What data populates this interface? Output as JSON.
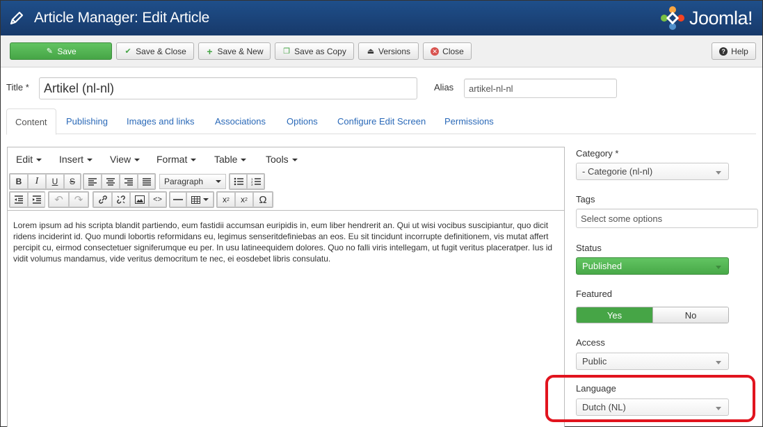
{
  "header": {
    "title": "Article Manager: Edit Article",
    "logo_text": "Joomla!",
    "bg_color": "#1f4f8a"
  },
  "toolbar": {
    "save": "Save",
    "save_close": "Save & Close",
    "save_new": "Save & New",
    "save_copy": "Save as Copy",
    "versions": "Versions",
    "close": "Close",
    "help": "Help"
  },
  "form": {
    "title_label": "Title *",
    "title_value": "Artikel (nl-nl)",
    "alias_label": "Alias",
    "alias_value": "artikel-nl-nl"
  },
  "tabs": [
    "Content",
    "Publishing",
    "Images and links",
    "Associations",
    "Options",
    "Configure Edit Screen",
    "Permissions"
  ],
  "editor": {
    "menus": [
      "Edit",
      "Insert",
      "View",
      "Format",
      "Table",
      "Tools"
    ],
    "format_select": "Paragraph",
    "body_text": "Lorem ipsum ad his scripta blandit partiendo, eum fastidii accumsan euripidis in, eum liber hendrerit an. Qui ut wisi vocibus suscipiantur, quo dicit ridens inciderint id. Quo mundi lobortis reformidans eu, legimus senseritdefiniebas an eos. Eu sit tincidunt incorrupte definitionem, vis mutat affert percipit cu, eirmod consectetuer signiferumque eu per. In usu latineequidem dolores. Quo no falli viris intellegam, ut fugit veritus placeratper. Ius id vidit volumus mandamus, vide veritus democritum te nec, ei eosdebet libris consulatu."
  },
  "sidebar": {
    "category_label": "Category *",
    "category_value": "- Categorie (nl-nl)",
    "tags_label": "Tags",
    "tags_placeholder": "Select some options",
    "status_label": "Status",
    "status_value": "Published",
    "featured_label": "Featured",
    "featured_yes": "Yes",
    "featured_no": "No",
    "access_label": "Access",
    "access_value": "Public",
    "language_label": "Language",
    "language_value": "Dutch (NL)"
  },
  "colors": {
    "success": "#46a546",
    "link": "#2a69b8",
    "highlight": "#e1141e"
  }
}
